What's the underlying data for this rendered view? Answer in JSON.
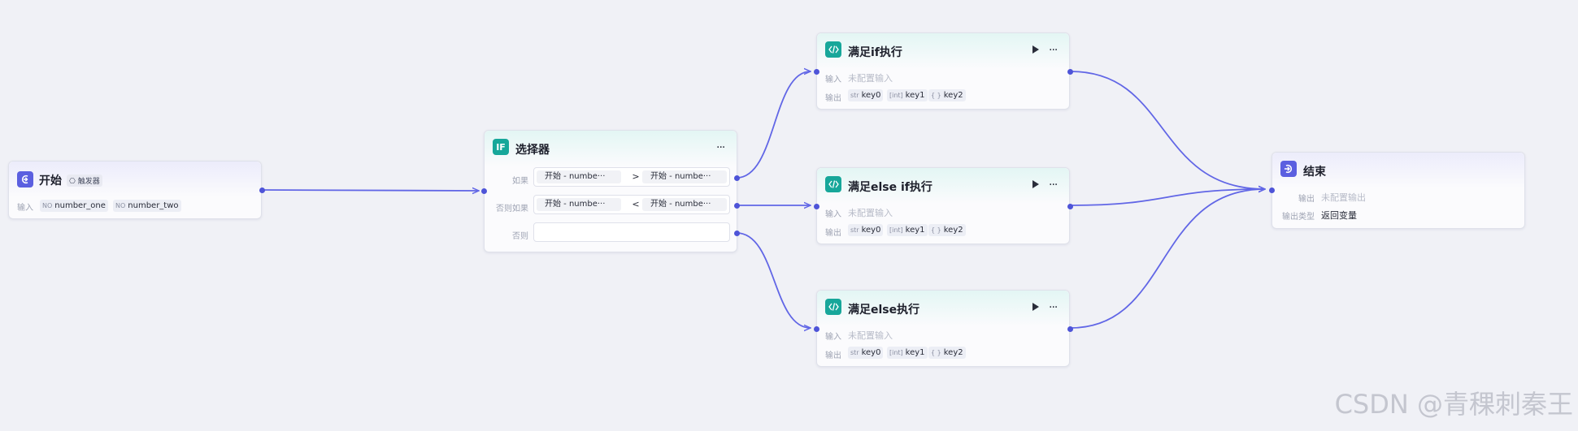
{
  "colors": {
    "background": "#f0f1f6",
    "edge": "#6166e6",
    "indigo": "#5b5fe0",
    "teal": "#17a79a"
  },
  "start_node": {
    "icon": "start-trigger-icon",
    "title": "开始",
    "trigger_tag": "触发器",
    "input_label": "输入",
    "inputs": [
      {
        "type": "NO",
        "name": "number_one"
      },
      {
        "type": "NO",
        "name": "number_two"
      }
    ]
  },
  "selector_node": {
    "icon_text": "IF",
    "title": "选择器",
    "conditions": [
      {
        "label": "如果",
        "left": "开始 - numbe···",
        "op": ">",
        "right": "开始 - numbe···"
      },
      {
        "label": "否则如果",
        "left": "开始 - numbe···",
        "op": "<",
        "right": "开始 - numbe···"
      }
    ],
    "else_label": "否则"
  },
  "code_nodes": [
    {
      "title": "满足if执行",
      "input_label": "输入",
      "input_value": "未配置输入",
      "output_label": "输出",
      "outputs": [
        {
          "type": "str",
          "name": "key0"
        },
        {
          "type": "[int]",
          "name": "key1"
        },
        {
          "type": "{ }",
          "name": "key2"
        }
      ]
    },
    {
      "title": "满足else if执行",
      "input_label": "输入",
      "input_value": "未配置输入",
      "output_label": "输出",
      "outputs": [
        {
          "type": "str",
          "name": "key0"
        },
        {
          "type": "[int]",
          "name": "key1"
        },
        {
          "type": "{ }",
          "name": "key2"
        }
      ]
    },
    {
      "title": "满足else执行",
      "input_label": "输入",
      "input_value": "未配置输入",
      "output_label": "输出",
      "outputs": [
        {
          "type": "str",
          "name": "key0"
        },
        {
          "type": "[int]",
          "name": "key1"
        },
        {
          "type": "{ }",
          "name": "key2"
        }
      ]
    }
  ],
  "end_node": {
    "icon": "end-exit-icon",
    "title": "结束",
    "output_label": "输出",
    "output_value": "未配置输出",
    "output_type_label": "输出类型",
    "output_type_value": "返回变量"
  },
  "watermark": "CSDN @青稞刺秦王"
}
